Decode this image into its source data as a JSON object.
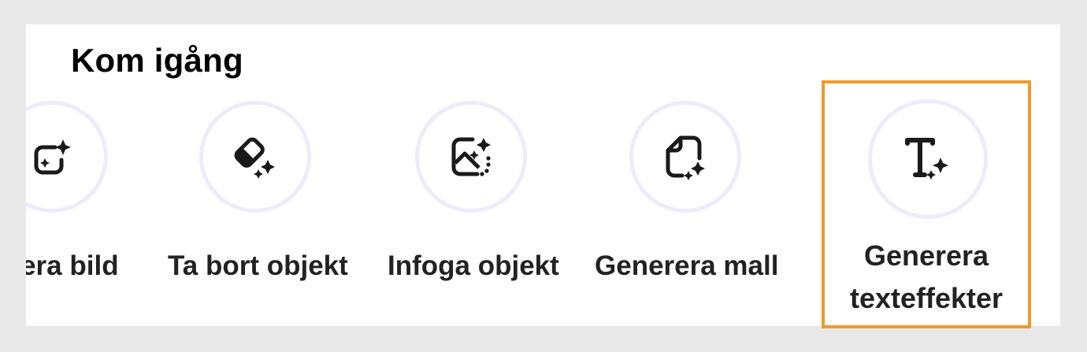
{
  "section": {
    "title": "Kom igång"
  },
  "actions": [
    {
      "id": "generate-image",
      "label": "erera bild",
      "icon": "image-sparkle-icon"
    },
    {
      "id": "remove-object",
      "label": "Ta bort objekt",
      "icon": "eraser-sparkle-icon"
    },
    {
      "id": "insert-object",
      "label": "Infoga objekt",
      "icon": "image-insert-sparkle-icon"
    },
    {
      "id": "generate-template",
      "label": "Generera mall",
      "icon": "template-sparkle-icon"
    },
    {
      "id": "generate-text-effects",
      "label": "Generera texteffekter",
      "icon": "text-sparkle-icon",
      "selected": true
    }
  ],
  "colors": {
    "highlight": "#f09a2e",
    "ring": "#ececfb",
    "icon": "#1a1a1a"
  }
}
